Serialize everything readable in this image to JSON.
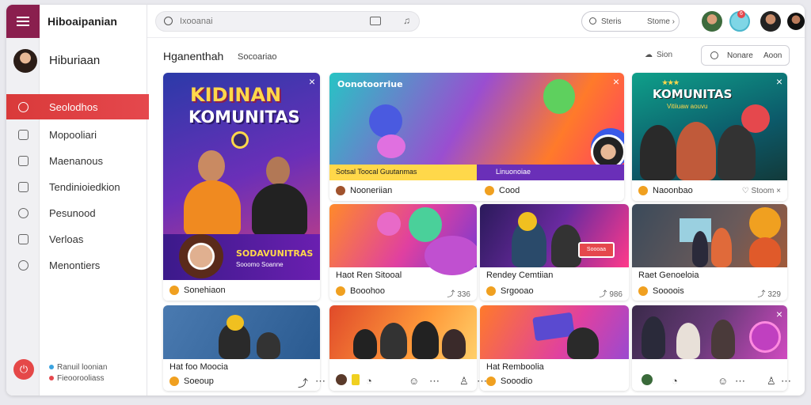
{
  "app": {
    "title": "Hiboaipanian"
  },
  "user": {
    "name": "Hiburiaan"
  },
  "sidebar": {
    "items": [
      {
        "label": "Seolodhos",
        "icon": "home-icon",
        "active": true
      },
      {
        "label": "Mopooliari",
        "icon": "grid-icon",
        "active": false
      },
      {
        "label": "Maenanous",
        "icon": "folder-icon",
        "active": false
      },
      {
        "label": "Tendinioiedkion",
        "icon": "bag-icon",
        "active": false
      },
      {
        "label": "Pesunood",
        "icon": "clock-icon",
        "active": false
      },
      {
        "label": "Verloas",
        "icon": "photo-icon",
        "active": false
      },
      {
        "label": "Menontiers",
        "icon": "heart-icon",
        "active": false
      }
    ],
    "footer": {
      "line1": "Ranuil loonian",
      "line2": "Fieoorooliass"
    }
  },
  "topbar": {
    "search_placeholder": "Ixooanai",
    "right_search": {
      "left": "Steris",
      "right": "Stome ›"
    },
    "notification_count": "6"
  },
  "subheader": {
    "title": "Hganenthah",
    "tab": "Socoariao",
    "tool1": "Sion",
    "tool2_left": "Nonare",
    "tool2_right": "Aoon"
  },
  "cards": [
    {
      "poster_title": "KIDINAN",
      "poster_sub": "KOMUNITAS",
      "banner": "SODAVUNITRAS",
      "banner_sub": "Sooomo Soanne",
      "footer": "Sonehiaon"
    },
    {
      "poster_title": "Oonotoorriue",
      "strip_left": "Sotsal Toocal Guutanmas",
      "strip_right": "Linuonoiae",
      "footer_left": "Nooneriian",
      "footer_right": "Cood"
    },
    {
      "poster_title": "KOMUNITAS",
      "poster_sub": "Vitiiuaw aouvu",
      "footer": "Naoonbao",
      "footer_right": "Stoom"
    },
    {
      "title": "Haot Ren Sitooal",
      "footer": "Booohoo",
      "footer_right": "336"
    },
    {
      "title": "Rendey Cemtiian",
      "footer": "Srgooao",
      "footer_right": "986",
      "banner": "Soooaa"
    },
    {
      "title": "Raet Genoeloia",
      "footer": "Soooois",
      "footer_right": "329"
    },
    {
      "title": "Hat foo Moocia",
      "footer": "Soeoup"
    },
    {
      "title": "Hat Remboolia",
      "footer": "Sooodio"
    }
  ],
  "colors": {
    "brand": "#8a1f4e",
    "accent": "#e5484d"
  }
}
